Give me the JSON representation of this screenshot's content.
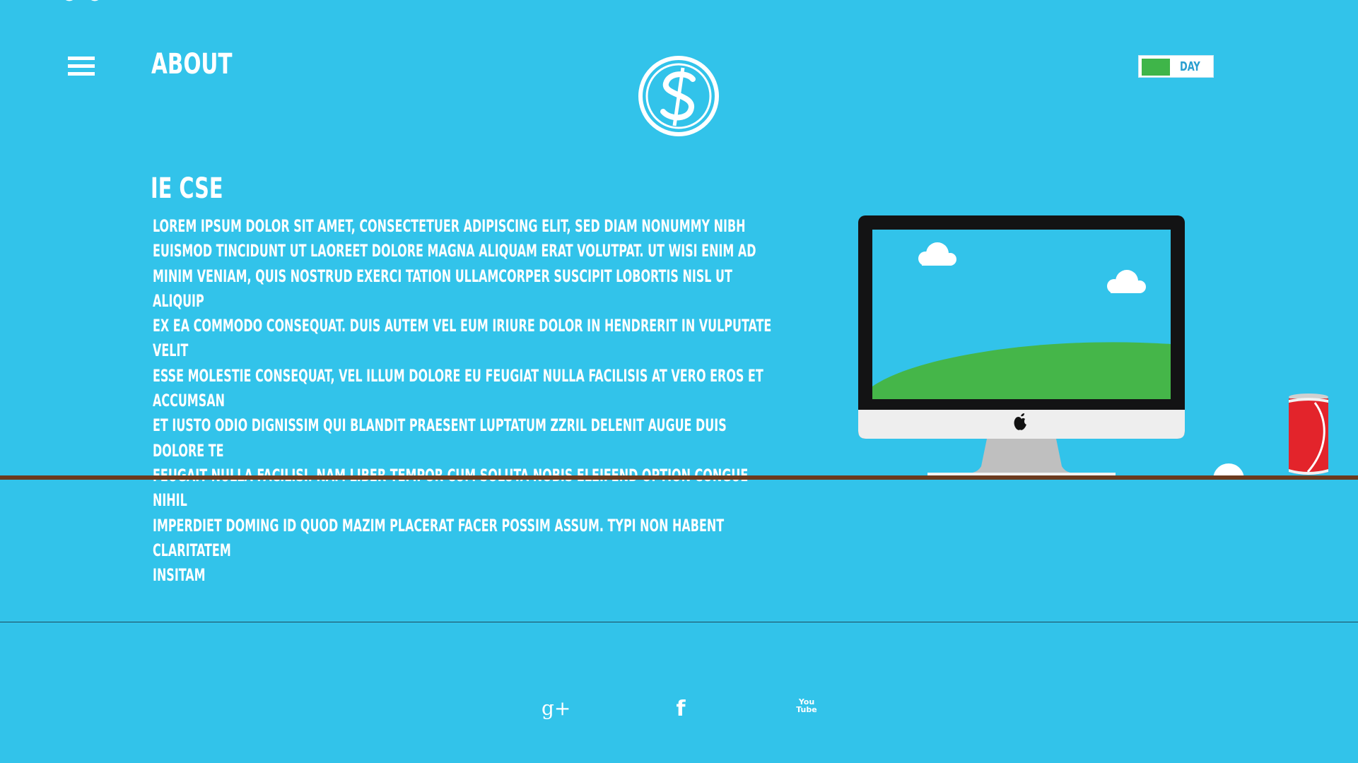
{
  "header": {
    "title": "About",
    "menu_icon": "hamburger-menu-icon",
    "logo_icon": "dollar-s-logo-icon"
  },
  "theme_toggle": {
    "label": "Day",
    "state": "on",
    "color_on": "#3fb549"
  },
  "content": {
    "heading": "IE CSE",
    "paragraph": "Lorem ipsum dolor sit amet, consectetuer adipiscing elit, sed diam nonummy nibh\neuismod tincidunt ut laoreet dolore magna aliquam erat volutpat. Ut wisi enim ad\nminim veniam, quis nostrud exerci tation ullamcorper suscipit lobortis nisl ut aliquip\nex ea commodo consequat. Duis autem vel eum iriure dolor in hendrerit in vulputate velit\nesse molestie consequat, vel illum dolore eu feugiat nulla facilisis at vero eros et accumsan\net iusto odio dignissim qui blandit praesent luptatum zzril delenit augue duis dolore te\nfeugait nulla facilisi. Nam liber tempor cum soluta nobis eleifend option congue nihil\nimperdiet doming id quod mazim placerat facer possim assum. Typi non habent claritatem\ninsitam"
  },
  "illustration": {
    "monitor": "desktop-computer-illustration",
    "mouse": "mouse-illustration",
    "can": "soda-can-illustration"
  },
  "footer": {
    "social": [
      {
        "name": "google-plus-icon",
        "glyph": "g+"
      },
      {
        "name": "facebook-icon",
        "glyph": "f"
      },
      {
        "name": "youtube-icon",
        "glyph": "You Tube"
      }
    ]
  },
  "colors": {
    "background": "#32c3ea",
    "shelf": "#6b3a1e",
    "grass": "#45b649",
    "can_red": "#e3242b"
  }
}
